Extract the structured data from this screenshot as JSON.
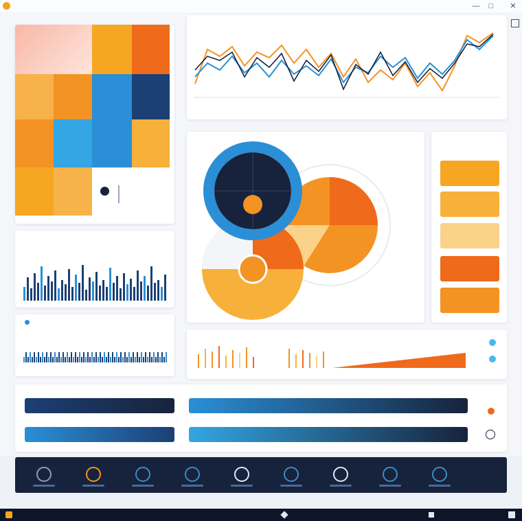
{
  "window": {
    "title": ""
  },
  "colors": {
    "orange": "#f39323",
    "deep_orange": "#ef6a1a",
    "amber": "#f7b03a",
    "light_orange": "#fbd28a",
    "blue": "#2a8fd6",
    "navy": "#1c3f74",
    "dark_navy": "#17233c",
    "cyan": "#49b9e6",
    "panel_bg": "#ffffff",
    "page_bg": "#eef1f5"
  },
  "icons": {
    "window": [
      "app-logo-icon",
      "minimize-icon",
      "maximize-icon",
      "close-icon",
      "panel-expand-icon"
    ],
    "nav": [
      "chart-icon",
      "settings-icon",
      "globe-icon",
      "user-icon",
      "gauge-icon",
      "shield-icon",
      "clock-icon",
      "user-icon",
      "globe-icon"
    ],
    "controls": [
      "toggle-icon",
      "toggle-icon",
      "gear-icon",
      "clock-icon",
      "info-icon"
    ]
  }
}
